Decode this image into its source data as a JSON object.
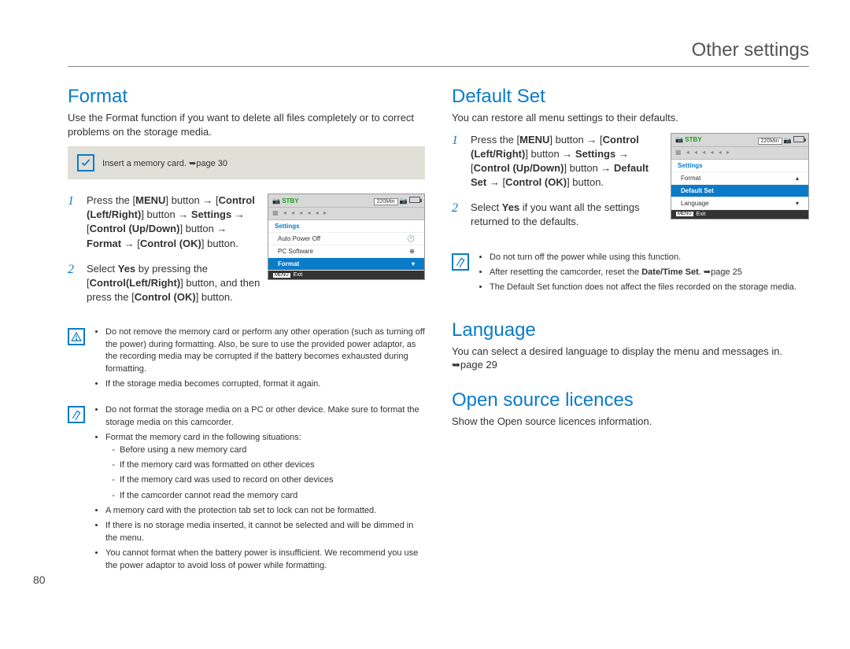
{
  "page": {
    "number": "80",
    "header": "Other settings"
  },
  "left": {
    "format": {
      "title": "Format",
      "lead": "Use the Format function if you want to delete all files completely or to correct problems on the storage media.",
      "notebar": "Insert a memory card. ➥page 30",
      "step1_a": "Press the [",
      "step1_menu": "MENU",
      "step1_b": "] button → [",
      "step1_clr": "Control (Left/Right)",
      "step1_c": "] button → ",
      "step1_settings": "Settings",
      "step1_d": " → [",
      "step1_cud": "Control (Up/Down)",
      "step1_e": "] button → ",
      "step1_format": "Format",
      "step1_f": " → [",
      "step1_cok": "Control (OK)",
      "step1_g": "] button.",
      "step2_a": "Select ",
      "step2_yes": "Yes",
      "step2_b": " by pressing the [",
      "step2_clr": "Control(Left/Right)",
      "step2_c": "] button, and then press the [",
      "step2_cok": "Control (OK)",
      "step2_d": "] button.",
      "warn1_1": "Do not remove the memory card or perform any other operation (such as turning off the power) during formatting. Also, be sure to use the provided power adaptor, as the recording media may be corrupted if the battery becomes exhausted during formatting.",
      "warn1_2": "If the storage media becomes corrupted, format it again.",
      "tip_1": "Do not format the storage media on a PC or other device. Make sure to format the storage media on this camcorder.",
      "tip_2": "Format the memory card in the following situations:",
      "tip_2a": "Before using a new memory card",
      "tip_2b": "If the memory card was formatted on other devices",
      "tip_2c": "If the memory card was used to record on other devices",
      "tip_2d": "If the camcorder cannot read the memory card",
      "tip_3": "A memory card with the protection tab set to lock can not be formatted.",
      "tip_4": "If there is no storage media inserted, it cannot be selected and will be dimmed in the menu.",
      "tip_5": "You cannot format when the battery power is insufficient. We recommend you use the power adaptor to avoid loss of power while formatting."
    },
    "lcd1": {
      "stby": "STBY",
      "time": "220Min",
      "settings": "Settings",
      "item1": "Auto Power Off",
      "item2": "PC Software",
      "item3": "Format",
      "exit": "Exit",
      "menu": "MENU"
    }
  },
  "right": {
    "default": {
      "title": "Default Set",
      "lead": "You can restore all menu settings to their defaults.",
      "step1_a": "Press the [",
      "step1_menu": "MENU",
      "step1_b": "] button → [",
      "step1_clr": "Control (Left/Right)",
      "step1_c": "] button → ",
      "step1_settings": "Settings",
      "step1_d": " → [",
      "step1_cud": "Control (Up/Down)",
      "step1_e": "] button → ",
      "step1_ds": "Default Set",
      "step1_f": " → [",
      "step1_cok": "Control (OK)",
      "step1_g": "] button.",
      "step2_a": "Select ",
      "step2_yes": "Yes",
      "step2_b": " if you want all the settings returned to the defaults.",
      "tip_1": "Do not turn off the power while using this function.",
      "tip_2a": "After resetting the camcorder, reset the ",
      "tip_2b": "Date/Time Set",
      "tip_2c": ". ➥page 25",
      "tip_3": "The Default Set function does not affect the files recorded on the storage media."
    },
    "lcd2": {
      "stby": "STBY",
      "time": "220Min",
      "settings": "Settings",
      "item1": "Format",
      "item2": "Default Set",
      "item3": "Language",
      "exit": "Exit",
      "menu": "MENU"
    },
    "language": {
      "title": "Language",
      "lead": "You can select a desired language to display the menu and messages in. ➥page 29"
    },
    "osl": {
      "title": "Open source licences",
      "lead": "Show the Open source licences information."
    }
  }
}
